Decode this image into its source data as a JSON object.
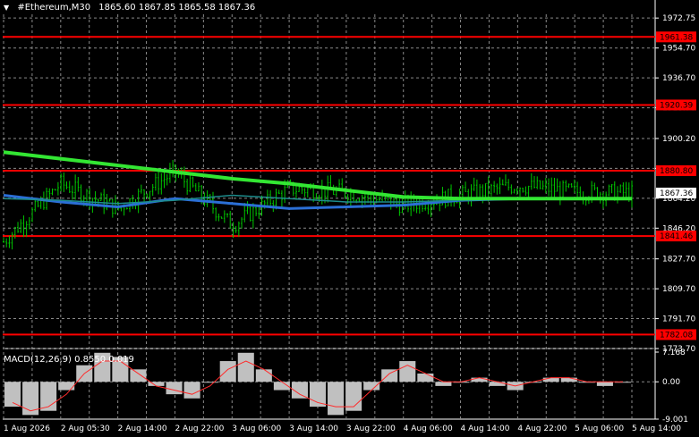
{
  "header": {
    "symbol_timeframe": "#Ethereum,M30",
    "ohlc": "1865.60 1867.85 1865.58 1867.36",
    "arrow_icon": "triangle-down-icon"
  },
  "macd": {
    "label": "MACD(12,26,9) 0.8550 0.019",
    "axis_labels": [
      "7.168",
      "0.00",
      "-9.001"
    ]
  },
  "price_axis_labels": [
    "1972.75",
    "1954.70",
    "1936.70",
    "1918.70",
    "1900.20",
    "1882.20",
    "1864.20",
    "1846.20",
    "1827.70",
    "1809.70",
    "1791.70",
    "1773.70"
  ],
  "levels": [
    {
      "label": "1961.38",
      "value": 1961.38
    },
    {
      "label": "1920.39",
      "value": 1920.39
    },
    {
      "label": "1880.80",
      "value": 1880.8
    },
    {
      "label": "1841.46",
      "value": 1841.46
    },
    {
      "label": "1782.08",
      "value": 1782.08
    }
  ],
  "current_price": {
    "label": "1867.36",
    "value": 1867.36
  },
  "time_labels": [
    "1 Aug 2026",
    "2 Aug 05:30",
    "2 Aug 14:00",
    "2 Aug 22:00",
    "3 Aug 06:00",
    "3 Aug 14:00",
    "3 Aug 22:00",
    "4 Aug 06:00",
    "4 Aug 14:00",
    "4 Aug 22:00",
    "5 Aug 06:00",
    "5 Aug 14:00"
  ],
  "colors": {
    "background": "#000000",
    "grid": "#8a8a8a",
    "level": "#ff0000",
    "level_label_text": "#000000",
    "candles": "#00c800",
    "ma_fast": "#2b6fd6",
    "ma_mid": "#1d8c8c",
    "ma_slow": "#33e633",
    "macd_hist": "#c0c0c0",
    "macd_signal": "#ff2a2a"
  },
  "chart_data": {
    "type": "line",
    "title": "#Ethereum,M30",
    "ylim": [
      1773.7,
      1975
    ],
    "x": [
      "1 Aug 2026",
      "2 Aug 05:30",
      "2 Aug 14:00",
      "2 Aug 22:00",
      "3 Aug 06:00",
      "3 Aug 14:00",
      "3 Aug 22:00",
      "4 Aug 06:00",
      "4 Aug 14:00",
      "4 Aug 22:00",
      "5 Aug 06:00",
      "5 Aug 14:00"
    ],
    "series": [
      {
        "values": [
          1838,
          1873,
          1858,
          1880,
          1848,
          1870,
          1868,
          1860,
          1866,
          1872,
          1868,
          1867.36
        ]
      },
      {
        "values": [
          1866,
          1862,
          1859,
          1864,
          1861,
          1858,
          1859,
          1860,
          1863,
          1864,
          1864,
          1864
        ]
      },
      {
        "values": [
          1864,
          1863,
          1861,
          1863,
          1866,
          1864,
          1862,
          1862,
          1863,
          1864,
          1864,
          1864
        ]
      },
      {
        "values": [
          1892,
          1888,
          1884,
          1880,
          1876,
          1873,
          1869,
          1865,
          1864,
          1864,
          1864,
          1864
        ]
      }
    ],
    "macd": {
      "ylim": [
        -9.001,
        7.168
      ],
      "histogram": [
        -6,
        -8,
        -7,
        -2,
        4,
        7,
        6,
        3,
        -1,
        -3,
        -4,
        0,
        5,
        7,
        3,
        -2,
        -4,
        -6,
        -8,
        -7,
        -2,
        3,
        5,
        2,
        -1,
        0,
        1,
        -1,
        -2,
        0,
        1,
        1,
        0,
        -1,
        0
      ],
      "signal": [
        -5,
        -7,
        -6,
        -3,
        2,
        5,
        5,
        2,
        -1,
        -2,
        -3,
        -1,
        3,
        5,
        3,
        0,
        -3,
        -5,
        -6,
        -6,
        -2,
        2,
        4,
        2,
        0,
        0,
        1,
        0,
        -1,
        0,
        1,
        1,
        0,
        0,
        0
      ]
    }
  }
}
